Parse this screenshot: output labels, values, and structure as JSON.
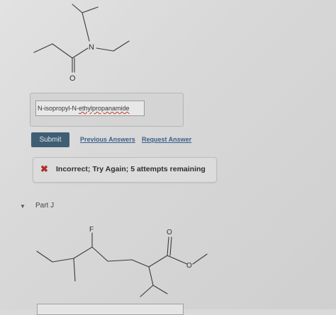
{
  "molecule_top": {
    "atoms": {
      "n": "N",
      "o": "O"
    }
  },
  "answer": {
    "value_plain": "N-isopropyl-N-",
    "value_misspelled": "ethylpropanamide"
  },
  "actions": {
    "submit_label": "Submit",
    "previous_answers_label": "Previous Answers",
    "request_answer_label": "Request Answer"
  },
  "feedback": {
    "icon": "x-icon",
    "text": "Incorrect; Try Again; 5 attempts remaining"
  },
  "part_j": {
    "label": "Part J",
    "toggle_icon": "triangle-down-icon",
    "atoms": {
      "f": "F",
      "o_carbonyl": "O",
      "o_ester": "O"
    }
  },
  "colors": {
    "submit_bg": "#3f5e73",
    "link": "#3b5f8a",
    "error": "#b22b2b"
  }
}
